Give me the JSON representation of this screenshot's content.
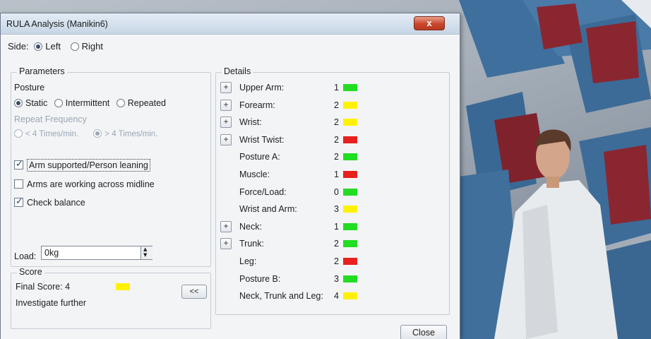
{
  "window": {
    "title": "RULA Analysis (Manikin6)",
    "close_glyph": "x"
  },
  "side": {
    "label": "Side:",
    "options": [
      {
        "label": "Left",
        "selected": true
      },
      {
        "label": "Right",
        "selected": false
      }
    ]
  },
  "parameters": {
    "group_label": "Parameters",
    "posture_label": "Posture",
    "posture_options": [
      {
        "label": "Static",
        "selected": true
      },
      {
        "label": "Intermittent",
        "selected": false
      },
      {
        "label": "Repeated",
        "selected": false
      }
    ],
    "repeat_frequency_label": "Repeat Frequency",
    "repeat_options": [
      {
        "label": "< 4 Times/min.",
        "selected": false
      },
      {
        "label": "> 4 Times/min.",
        "selected": true
      }
    ],
    "checkboxes": [
      {
        "label": "Arm supported/Person leaning",
        "checked": true
      },
      {
        "label": "Arms are working across midline",
        "checked": false
      },
      {
        "label": "Check balance",
        "checked": true
      }
    ],
    "load_label": "Load:",
    "load_value": "0kg"
  },
  "score": {
    "group_label": "Score",
    "final_score_text": "Final Score: 4",
    "final_color": "#fff200",
    "recommendation": "Investigate further",
    "collapse_label": "<<"
  },
  "details": {
    "group_label": "Details",
    "rows": [
      {
        "expandable": true,
        "label": "Upper Arm:",
        "value": "1",
        "color": "#22dd22"
      },
      {
        "expandable": true,
        "label": "Forearm:",
        "value": "2",
        "color": "#fff200"
      },
      {
        "expandable": true,
        "label": "Wrist:",
        "value": "2",
        "color": "#fff200"
      },
      {
        "expandable": true,
        "label": "Wrist Twist:",
        "value": "2",
        "color": "#e8201e"
      },
      {
        "expandable": false,
        "label": "Posture A:",
        "value": "2",
        "color": "#22dd22"
      },
      {
        "expandable": false,
        "label": "Muscle:",
        "value": "1",
        "color": "#e8201e"
      },
      {
        "expandable": false,
        "label": "Force/Load:",
        "value": "0",
        "color": "#22dd22"
      },
      {
        "expandable": false,
        "label": "Wrist and Arm:",
        "value": "3",
        "color": "#fff200"
      },
      {
        "expandable": true,
        "label": "Neck:",
        "value": "1",
        "color": "#22dd22"
      },
      {
        "expandable": true,
        "label": "Trunk:",
        "value": "2",
        "color": "#22dd22"
      },
      {
        "expandable": false,
        "label": "Leg:",
        "value": "2",
        "color": "#e8201e"
      },
      {
        "expandable": false,
        "label": "Posture B:",
        "value": "3",
        "color": "#22dd22"
      },
      {
        "expandable": false,
        "label": "Neck, Trunk and Leg:",
        "value": "4",
        "color": "#fff200"
      }
    ],
    "expand_glyph": "+"
  },
  "footer": {
    "close_label": "Close"
  },
  "colors": {
    "green": "#22dd22",
    "yellow": "#fff200",
    "red": "#e8201e"
  }
}
